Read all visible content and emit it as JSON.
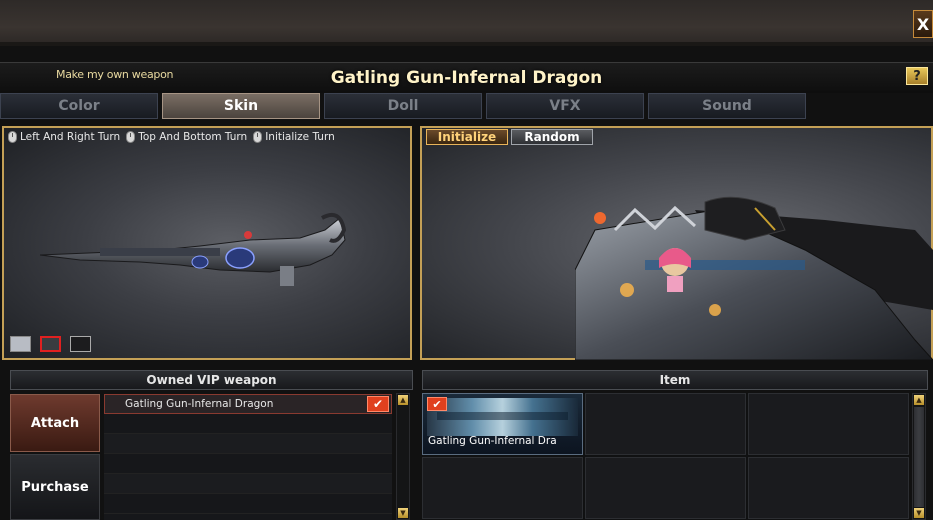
{
  "window": {
    "subtitle": "Make my own weapon",
    "title": "Gatling Gun-Infernal Dragon",
    "close_label": "X",
    "help_label": "?"
  },
  "tabs": [
    {
      "label": "Color",
      "active": false
    },
    {
      "label": "Skin",
      "active": true
    },
    {
      "label": "Doll",
      "active": false
    },
    {
      "label": "VFX",
      "active": false
    },
    {
      "label": "Sound",
      "active": false
    }
  ],
  "preview": {
    "hints": [
      "Left And Right Turn",
      "Top And Bottom Turn",
      "Initialize Turn"
    ],
    "swatches": [
      "light-gray",
      "dark-gray-selected",
      "black"
    ]
  },
  "viewer": {
    "initialize_label": "Initialize",
    "random_label": "Random"
  },
  "owned": {
    "header": "Owned VIP weapon",
    "attach_label": "Attach",
    "purchase_label": "Purchase",
    "items": [
      "Gatling Gun-Infernal Dragon"
    ]
  },
  "item": {
    "header": "Item",
    "cells": [
      {
        "label": "Gatling Gun-Infernal Dra",
        "checked": true
      }
    ]
  },
  "colors": {
    "accent_gold": "#c4a056",
    "check_red": "#e0401e"
  }
}
